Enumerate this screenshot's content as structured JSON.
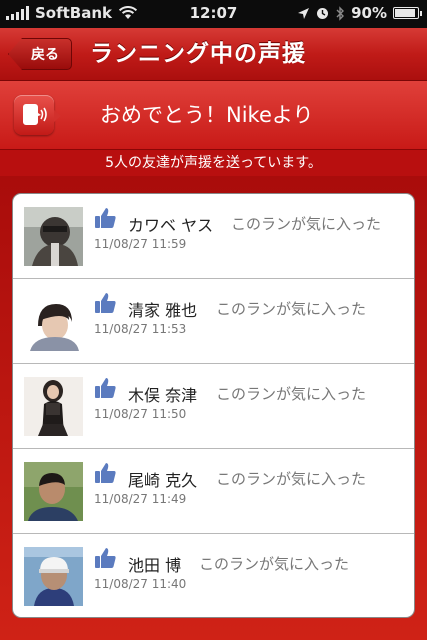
{
  "status": {
    "carrier": "SoftBank",
    "time": "12:07",
    "battery": "90%",
    "battery_level": 0.9
  },
  "nav": {
    "back_label": "戻る",
    "title": "ランニング中の声援"
  },
  "banner": {
    "text": "おめでとう！Nikeより"
  },
  "subtitle": "5人の友達が声援を送っています。",
  "colors": {
    "brand_red": "#c01b18",
    "like_blue": "#5b7bbf"
  },
  "cheers": [
    {
      "name": "カワベ ヤス",
      "message": "このランが気に入った",
      "date": "11/08/27  11:59",
      "icon": "like-thumb-icon"
    },
    {
      "name": "清家 雅也",
      "message": "このランが気に入った",
      "date": "11/08/27  11:53",
      "icon": "like-thumb-icon"
    },
    {
      "name": "木俣 奈津",
      "message": "このランが気に入った",
      "date": "11/08/27  11:50",
      "icon": "like-thumb-icon"
    },
    {
      "name": "尾崎 克久",
      "message": "このランが気に入った",
      "date": "11/08/27  11:49",
      "icon": "like-thumb-icon"
    },
    {
      "name": "池田 博",
      "message": "このランが気に入った",
      "date": "11/08/27  11:40",
      "icon": "like-thumb-icon"
    }
  ]
}
